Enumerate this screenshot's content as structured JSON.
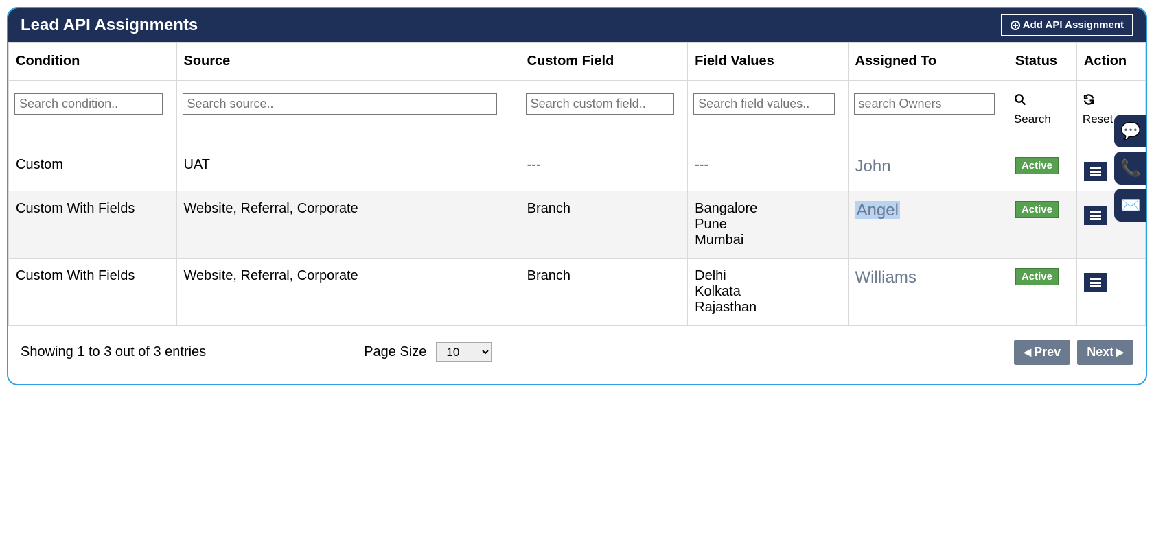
{
  "header": {
    "title": "Lead API Assignments",
    "add_button": "Add API Assignment"
  },
  "columns": {
    "condition": "Condition",
    "source": "Source",
    "custom_field": "Custom Field",
    "field_values": "Field Values",
    "assigned_to": "Assigned To",
    "status": "Status",
    "action": "Action"
  },
  "filters": {
    "condition_ph": "Search condition..",
    "source_ph": "Search source..",
    "custom_ph": "Search custom field..",
    "values_ph": "Search field values..",
    "owners_ph": "search Owners",
    "search_label": "Search",
    "reset_label": "Reset"
  },
  "rows": [
    {
      "condition": "Custom",
      "source": "UAT",
      "custom_field": "---",
      "field_values": "---",
      "assigned": "John",
      "assigned_highlight": false,
      "status": "Active"
    },
    {
      "condition": "Custom With Fields",
      "source": "Website, Referral, Corporate",
      "custom_field": "Branch",
      "field_values": "Bangalore\nPune\nMumbai",
      "assigned": "Angel",
      "assigned_highlight": true,
      "status": "Active"
    },
    {
      "condition": "Custom With Fields",
      "source": "Website, Referral, Corporate",
      "custom_field": "Branch",
      "field_values": "Delhi\nKolkata\nRajasthan",
      "assigned": "Williams",
      "assigned_highlight": false,
      "status": "Active"
    }
  ],
  "footer": {
    "info": "Showing 1 to 3 out of 3 entries",
    "page_size_label": "Page Size",
    "page_size_value": "10",
    "prev": "Prev",
    "next": "Next"
  },
  "side": {
    "chat": "chat-icon",
    "phone": "phone-icon",
    "mail": "mail-icon"
  }
}
